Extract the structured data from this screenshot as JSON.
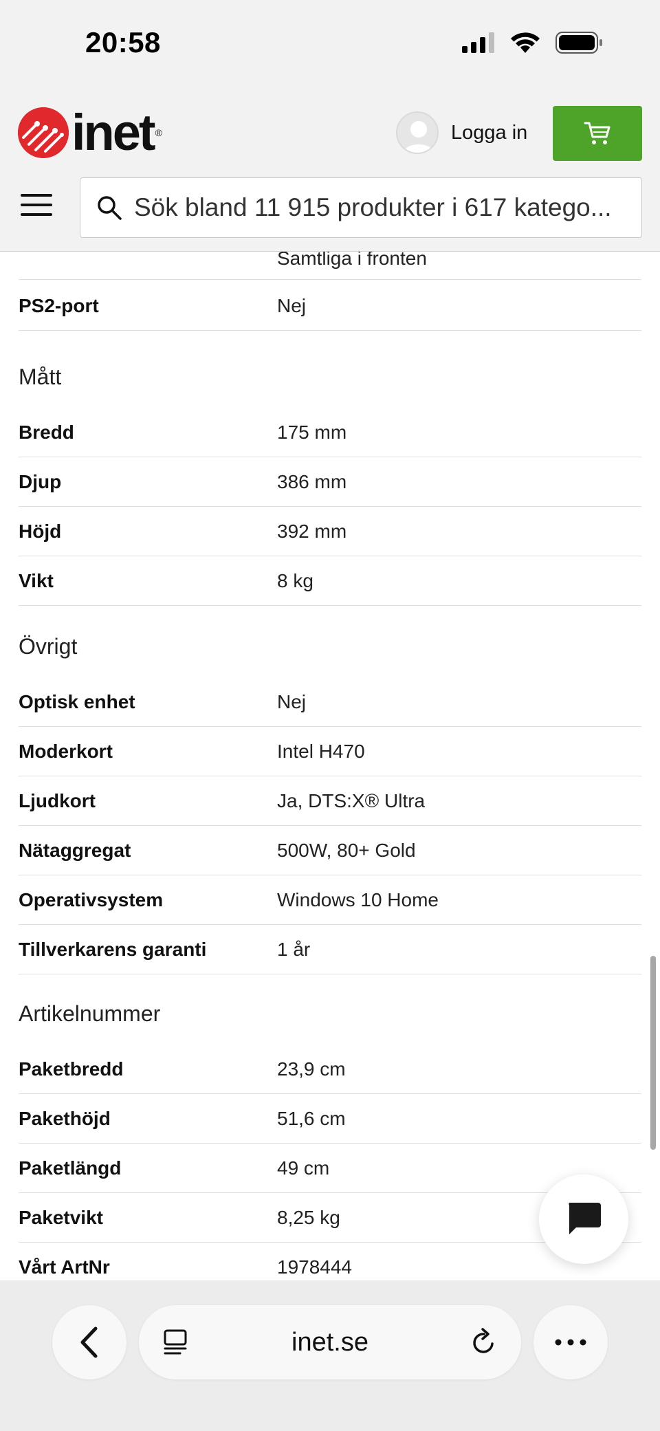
{
  "status_bar": {
    "time": "20:58"
  },
  "header": {
    "logo_text": "inet",
    "login_label": "Logga in",
    "search_placeholder": "Sök bland 11 915 produkter i 617 katego..."
  },
  "specs": {
    "partial_value": "Samtliga i fronten",
    "ps2": {
      "key": "PS2-port",
      "value": "Nej"
    },
    "sections": [
      {
        "title": "Mått",
        "rows": [
          {
            "key": "Bredd",
            "value": "175 mm"
          },
          {
            "key": "Djup",
            "value": "386 mm"
          },
          {
            "key": "Höjd",
            "value": "392 mm"
          },
          {
            "key": "Vikt",
            "value": "8 kg"
          }
        ]
      },
      {
        "title": "Övrigt",
        "rows": [
          {
            "key": "Optisk enhet",
            "value": "Nej"
          },
          {
            "key": "Moderkort",
            "value": "Intel H470"
          },
          {
            "key": "Ljudkort",
            "value": "Ja, DTS:X® Ultra"
          },
          {
            "key": "Nätaggregat",
            "value": "500W, 80+ Gold"
          },
          {
            "key": "Operativsystem",
            "value": "Windows 10 Home"
          },
          {
            "key": "Tillverkarens garanti",
            "value": "1 år"
          }
        ]
      },
      {
        "title": "Artikelnummer",
        "rows": [
          {
            "key": "Paketbredd",
            "value": "23,9 cm"
          },
          {
            "key": "Pakethöjd",
            "value": "51,6 cm"
          },
          {
            "key": "Paketlängd",
            "value": "49 cm"
          },
          {
            "key": "Paketvikt",
            "value": "8,25 kg"
          },
          {
            "key": "Vårt ArtNr",
            "value": "1978444"
          }
        ]
      }
    ]
  },
  "browser": {
    "url": "inet.se"
  },
  "colors": {
    "brand_red": "#e0282d",
    "cart_green": "#4da429"
  }
}
